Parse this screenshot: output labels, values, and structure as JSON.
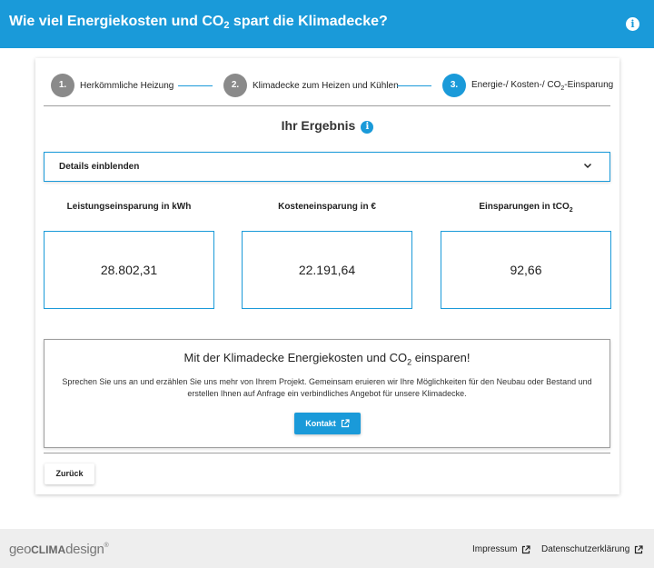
{
  "header": {
    "title_prefix": "Wie viel Energiekosten und CO",
    "title_sub": "2",
    "title_suffix": " spart die Klimadecke?",
    "info_icon": "info-icon"
  },
  "steps": [
    {
      "number": "1.",
      "label": "Herkömmliche Heizung",
      "state": "completed"
    },
    {
      "number": "2.",
      "label": "Klimadecke zum Heizen und Kühlen",
      "state": "completed"
    },
    {
      "number": "3.",
      "label_prefix": "Energie-/ Kosten-/ CO",
      "label_sub": "2",
      "label_suffix": "-Einsparung",
      "state": "active"
    }
  ],
  "result": {
    "title": "Ihr Ergebnis",
    "details_label": "Details einblenden"
  },
  "metrics": [
    {
      "label": "Leistungseinsparung in kWh",
      "value": "28.802,31"
    },
    {
      "label": "Kosteneinsparung in €",
      "value": "22.191,64"
    },
    {
      "label_prefix": "Einsparungen in tCO",
      "label_sub": "2",
      "value": "92,66"
    }
  ],
  "cta": {
    "title_prefix": "Mit der Klimadecke Energiekosten und CO",
    "title_sub": "2",
    "title_suffix": " einsparen!",
    "text": "Sprechen Sie uns an und erzählen Sie uns mehr von Ihrem Projekt. Gemeinsam eruieren wir Ihre Möglichkeiten für den Neubau oder Bestand und erstellen Ihnen auf Anfrage ein verbindliches Angebot für unsere Klimadecke.",
    "button_label": "Kontakt"
  },
  "nav": {
    "back_label": "Zurück"
  },
  "footer": {
    "logo_geo": "geo",
    "logo_clima": "CLIMA",
    "logo_design": "design",
    "logo_reg": "®",
    "impressum": "Impressum",
    "datenschutz": "Datenschutzerklärung"
  },
  "colors": {
    "accent": "#1a9ad9",
    "step_inactive": "#8a8a8a",
    "footer_bg": "#eeeeee"
  }
}
